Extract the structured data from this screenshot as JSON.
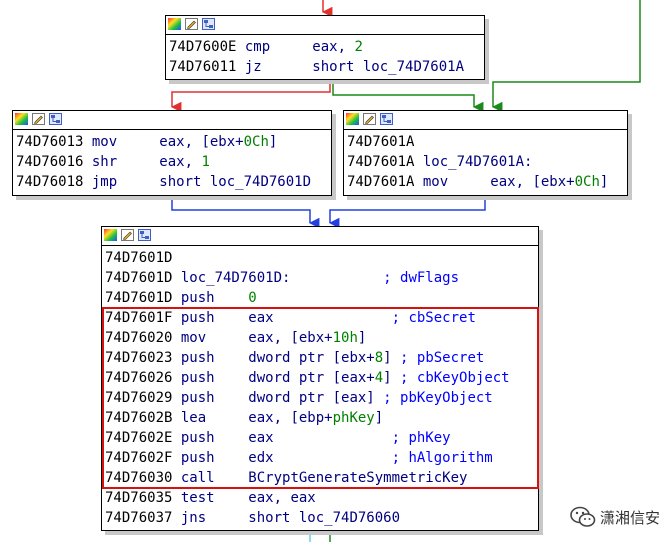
{
  "colors": {
    "edge_false": "#e03030",
    "edge_true": "#1a8a1a",
    "edge_unconditional": "#2040e0",
    "highlight": "#d71010",
    "address": "#000000",
    "mnemonic": "#000080",
    "number": "#008000",
    "comment": "#0000ff"
  },
  "toolbar_icons": [
    "color-palette-icon",
    "edit-node-icon",
    "graph-view-icon"
  ],
  "blocks": {
    "top": {
      "lines": [
        [
          {
            "t": "74D7600E ",
            "c": "addr"
          },
          {
            "t": "cmp     ",
            "c": "mnem"
          },
          {
            "t": "eax, ",
            "c": "mnem"
          },
          {
            "t": "2",
            "c": "num"
          }
        ],
        [
          {
            "t": "74D76011 ",
            "c": "addr"
          },
          {
            "t": "jz      ",
            "c": "mnem"
          },
          {
            "t": "short loc_74D7601A",
            "c": "mnem"
          }
        ]
      ]
    },
    "left": {
      "lines": [
        [
          {
            "t": "74D76013 ",
            "c": "addr"
          },
          {
            "t": "mov     ",
            "c": "mnem"
          },
          {
            "t": "eax, [ebx+",
            "c": "mnem"
          },
          {
            "t": "0Ch",
            "c": "num"
          },
          {
            "t": "]",
            "c": "mnem"
          }
        ],
        [
          {
            "t": "74D76016 ",
            "c": "addr"
          },
          {
            "t": "shr     ",
            "c": "mnem"
          },
          {
            "t": "eax, ",
            "c": "mnem"
          },
          {
            "t": "1",
            "c": "num"
          }
        ],
        [
          {
            "t": "74D76018 ",
            "c": "addr"
          },
          {
            "t": "jmp     ",
            "c": "mnem"
          },
          {
            "t": "short loc_74D7601D",
            "c": "mnem"
          }
        ]
      ]
    },
    "right": {
      "lines": [
        [
          {
            "t": "74D7601A",
            "c": "addr"
          }
        ],
        [
          {
            "t": "74D7601A ",
            "c": "addr"
          },
          {
            "t": "loc_74D7601A:",
            "c": "lbl"
          }
        ],
        [
          {
            "t": "74D7601A ",
            "c": "addr"
          },
          {
            "t": "mov     ",
            "c": "mnem"
          },
          {
            "t": "eax, [ebx+",
            "c": "mnem"
          },
          {
            "t": "0Ch",
            "c": "num"
          },
          {
            "t": "]",
            "c": "mnem"
          }
        ]
      ]
    },
    "bottom": {
      "lines": [
        [
          {
            "t": "74D7601D",
            "c": "addr"
          }
        ],
        [
          {
            "t": "74D7601D ",
            "c": "addr"
          },
          {
            "t": "loc_74D7601D:           ",
            "c": "lbl"
          },
          {
            "t": "; dwFlags",
            "c": "cmt"
          }
        ],
        [
          {
            "t": "74D7601D ",
            "c": "addr"
          },
          {
            "t": "push    ",
            "c": "mnem"
          },
          {
            "t": "0",
            "c": "num"
          }
        ],
        [
          {
            "t": "74D7601F ",
            "c": "addr"
          },
          {
            "t": "push    ",
            "c": "mnem"
          },
          {
            "t": "eax              ",
            "c": "mnem"
          },
          {
            "t": "; cbSecret",
            "c": "cmt"
          }
        ],
        [
          {
            "t": "74D76020 ",
            "c": "addr"
          },
          {
            "t": "mov     ",
            "c": "mnem"
          },
          {
            "t": "eax, [ebx+",
            "c": "mnem"
          },
          {
            "t": "10h",
            "c": "num"
          },
          {
            "t": "]",
            "c": "mnem"
          }
        ],
        [
          {
            "t": "74D76023 ",
            "c": "addr"
          },
          {
            "t": "push    ",
            "c": "mnem"
          },
          {
            "t": "dword ptr [ebx+",
            "c": "mnem"
          },
          {
            "t": "8",
            "c": "num"
          },
          {
            "t": "] ",
            "c": "mnem"
          },
          {
            "t": "; pbSecret",
            "c": "cmt"
          }
        ],
        [
          {
            "t": "74D76026 ",
            "c": "addr"
          },
          {
            "t": "push    ",
            "c": "mnem"
          },
          {
            "t": "dword ptr [eax+",
            "c": "mnem"
          },
          {
            "t": "4",
            "c": "num"
          },
          {
            "t": "] ",
            "c": "mnem"
          },
          {
            "t": "; cbKeyObject",
            "c": "cmt"
          }
        ],
        [
          {
            "t": "74D76029 ",
            "c": "addr"
          },
          {
            "t": "push    ",
            "c": "mnem"
          },
          {
            "t": "dword ptr [eax] ",
            "c": "mnem"
          },
          {
            "t": "; pbKeyObject",
            "c": "cmt"
          }
        ],
        [
          {
            "t": "74D7602B ",
            "c": "addr"
          },
          {
            "t": "lea     ",
            "c": "mnem"
          },
          {
            "t": "eax, [ebp+",
            "c": "mnem"
          },
          {
            "t": "phKey",
            "c": "num"
          },
          {
            "t": "]",
            "c": "mnem"
          }
        ],
        [
          {
            "t": "74D7602E ",
            "c": "addr"
          },
          {
            "t": "push    ",
            "c": "mnem"
          },
          {
            "t": "eax              ",
            "c": "mnem"
          },
          {
            "t": "; phKey",
            "c": "cmt"
          }
        ],
        [
          {
            "t": "74D7602F ",
            "c": "addr"
          },
          {
            "t": "push    ",
            "c": "mnem"
          },
          {
            "t": "edx              ",
            "c": "mnem"
          },
          {
            "t": "; hAlgorithm",
            "c": "cmt"
          }
        ],
        [
          {
            "t": "74D76030 ",
            "c": "addr"
          },
          {
            "t": "call    ",
            "c": "mnem"
          },
          {
            "t": "BCryptGenerateSymmetricKey",
            "c": "mnem"
          }
        ],
        [
          {
            "t": "74D76035 ",
            "c": "addr"
          },
          {
            "t": "test    ",
            "c": "mnem"
          },
          {
            "t": "eax, eax",
            "c": "mnem"
          }
        ],
        [
          {
            "t": "74D76037 ",
            "c": "addr"
          },
          {
            "t": "jns     ",
            "c": "mnem"
          },
          {
            "t": "short loc_74D76060",
            "c": "mnem"
          }
        ]
      ]
    }
  },
  "highlight_rows": {
    "block": "bottom",
    "first": 3,
    "last": 11
  },
  "watermark": {
    "icon": "wechat-icon",
    "text": "潇湘信安"
  }
}
